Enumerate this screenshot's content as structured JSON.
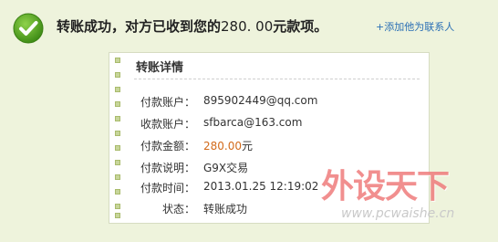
{
  "header": {
    "title_prefix": "转账成功，对方已收到您的",
    "amount": "280. 00",
    "title_suffix": "元款项。",
    "add_contact": "+添加他为联系人"
  },
  "card": {
    "heading": "转账详情",
    "rows": [
      {
        "label": "付款账户：",
        "value": "895902449@qq.com"
      },
      {
        "label": "收款账户：",
        "value": "sfbarca@163.com"
      },
      {
        "label": "付款金额：",
        "amount": "280.00",
        "unit": "元"
      },
      {
        "label": "付款说明：",
        "value": "G9X交易"
      },
      {
        "label": "付款时间：",
        "value": "2013.01.25 12:19:02"
      },
      {
        "label": "状态：",
        "value": "转账成功"
      }
    ]
  },
  "watermark": {
    "logo": "外设天下",
    "url": "www.pcwaishe.cn"
  },
  "colors": {
    "success_green": "#4c9a1e",
    "link_blue": "#2a6fb5",
    "amount_orange": "#d26a1a",
    "background": "#eef3dc"
  },
  "icons": {
    "status": "check-icon"
  }
}
